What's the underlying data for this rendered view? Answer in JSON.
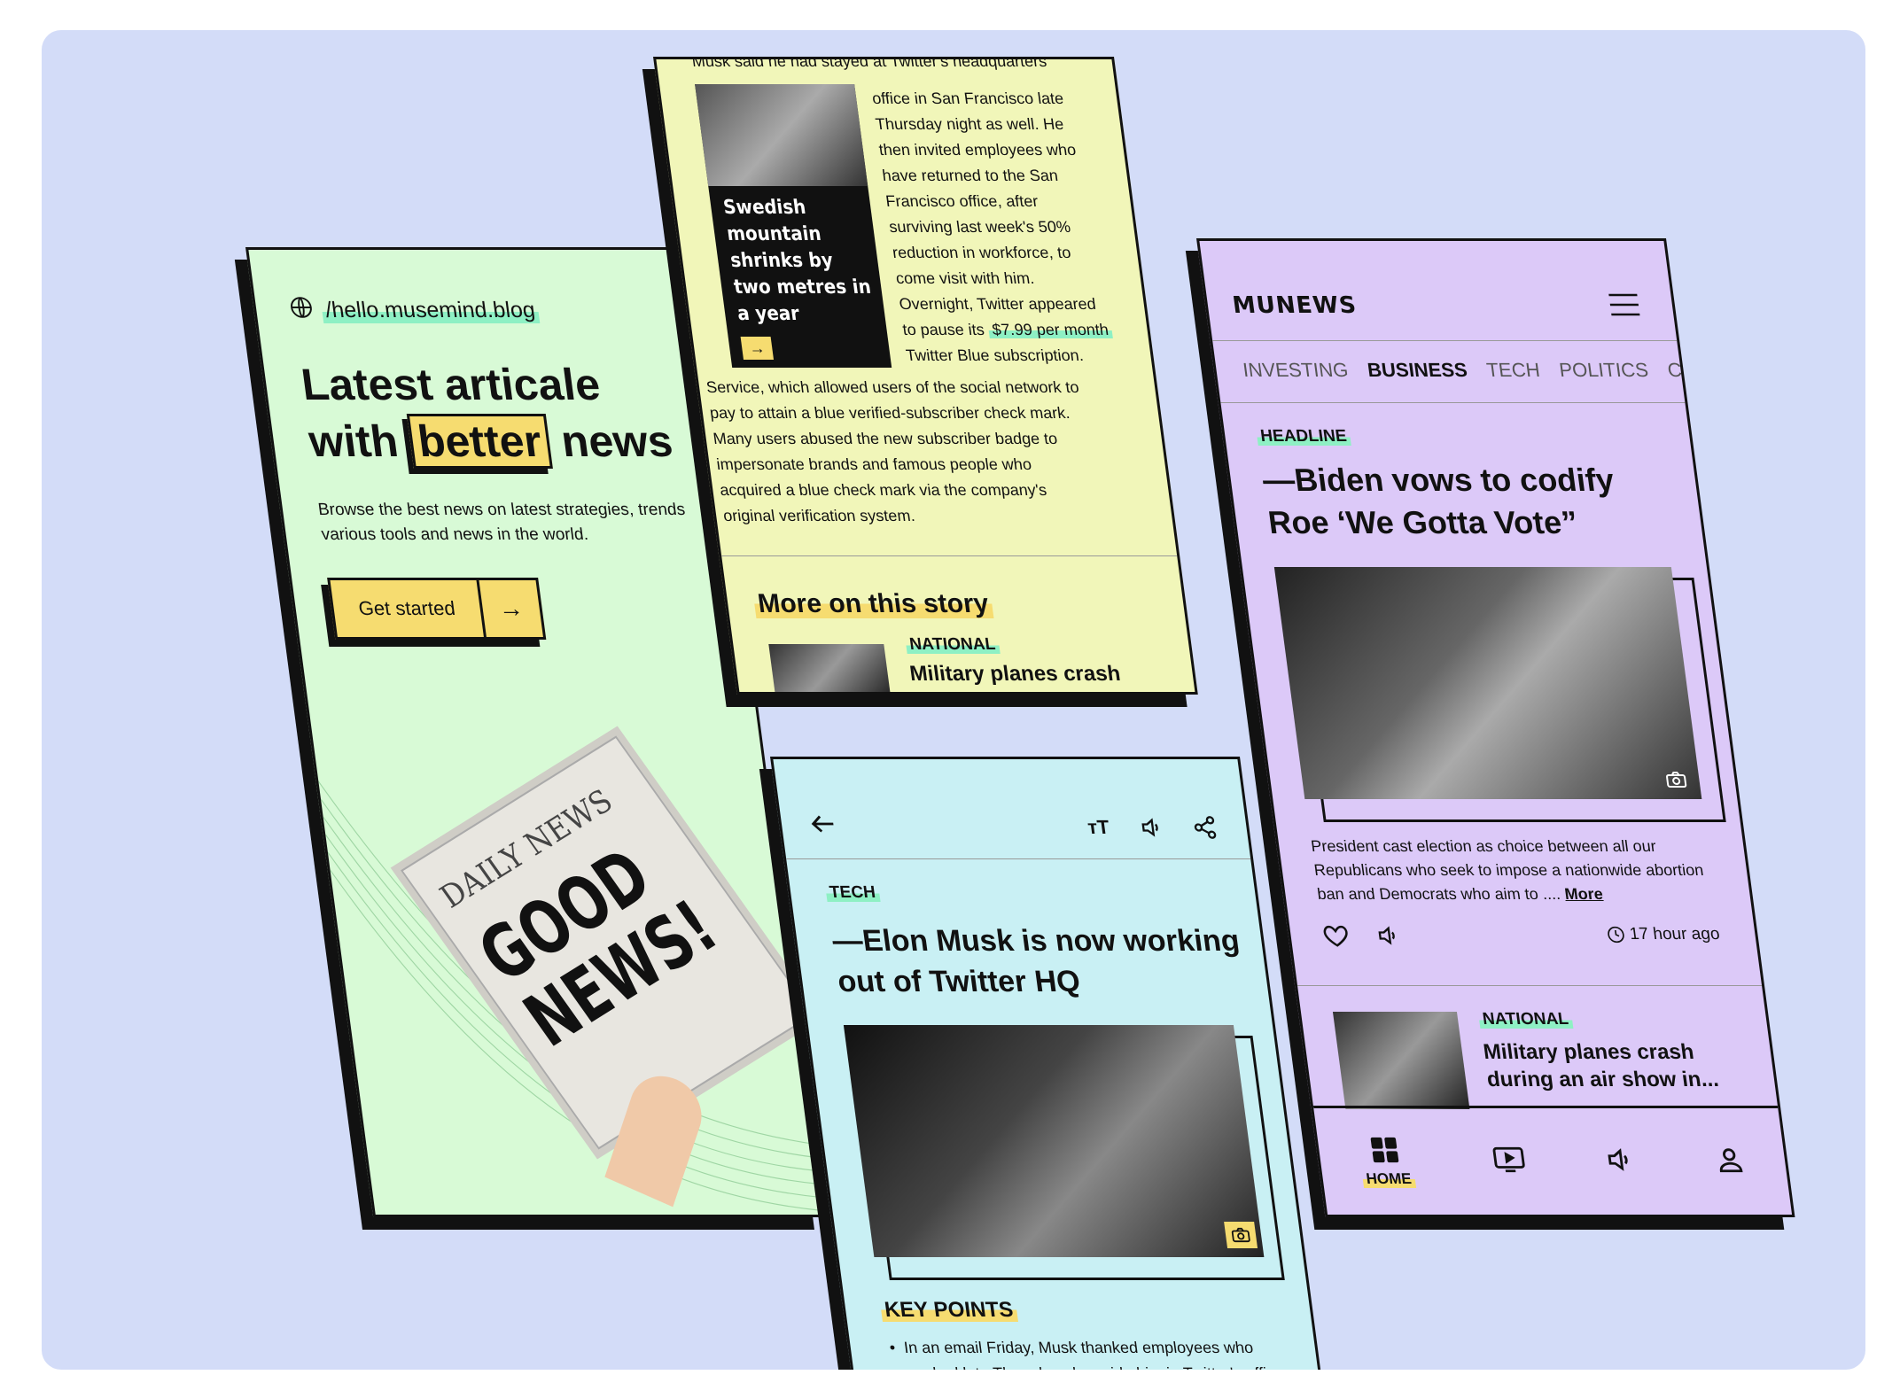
{
  "green": {
    "url": "/hello.musemind.blog",
    "headline_1": "Latest articale",
    "headline_2_pre": "with",
    "headline_2_box": "better",
    "headline_2_post": "news",
    "subtitle": "Browse the best news on latest strategies, trends various tools and news in the world.",
    "cta_label": "Get started",
    "cta_arrow": "→",
    "paper_masthead": "DAILY NEWS",
    "paper_headline": "GOOD NEWS!"
  },
  "yellow": {
    "top_cut": "Musk said he had stayed at Twitter's headquarters",
    "img_caption": "Swedish mountain shrinks by two metres in a year",
    "img_button": "→",
    "col_lines": [
      "office in San Francisco late",
      "Thursday night as well. He",
      "then invited employees who",
      "have returned to the San",
      "Francisco office, after",
      "surviving last week's 50%",
      "reduction in workforce, to",
      "come visit with him.",
      "Overnight, Twitter appeared"
    ],
    "price_pre": "to pause its",
    "price_hl": "$7.99 per month",
    "price_post": "Twitter Blue subscription.",
    "body_lines": [
      "Service, which allowed users of the social network to",
      "pay to attain a blue verified-subscriber check mark.",
      "Many users abused the new subscriber badge to",
      "impersonate brands and famous people who",
      "acquired a blue check mark via the company's",
      "original verification system."
    ],
    "more_title": "More on this story",
    "more_cat": "NATIONAL",
    "more_headline": "Military planes  crash"
  },
  "cyan": {
    "category": "TECH",
    "headline": "—Elon Musk is now working out of Twitter HQ",
    "key_points_title": "KEY POINTS",
    "bullet": "In an email Friday, Musk thanked employees who worked late Thursday alongside him in Twitter's offices and invited them to visit him in person"
  },
  "purple": {
    "logo": "MUNEWS",
    "tabs": [
      "INVESTING",
      "BUSINESS",
      "TECH",
      "POLITICS",
      "C"
    ],
    "active_tab": "BUSINESS",
    "category": "HEADLINE",
    "headline": "—Biden vows to codify Roe ‘We Gotta Vote”",
    "summary": "President cast election as choice between all our Republicans who seek to impose a nationwide abortion ban and Democrats who aim to ....",
    "more_link": "More",
    "time_ago": "17 hour ago",
    "next_cat": "NATIONAL",
    "next_headline": "Military planes  crash during an air show in...",
    "nav_home": "HOME"
  },
  "colors": {
    "background": "#d3dcf8",
    "green_card": "#d8fad6",
    "yellow_card": "#f1f6b9",
    "cyan_card": "#c9f0f4",
    "purple_card": "#dcc9f8",
    "accent_yellow": "#f6dc70",
    "accent_mint": "#8ef0c4"
  }
}
